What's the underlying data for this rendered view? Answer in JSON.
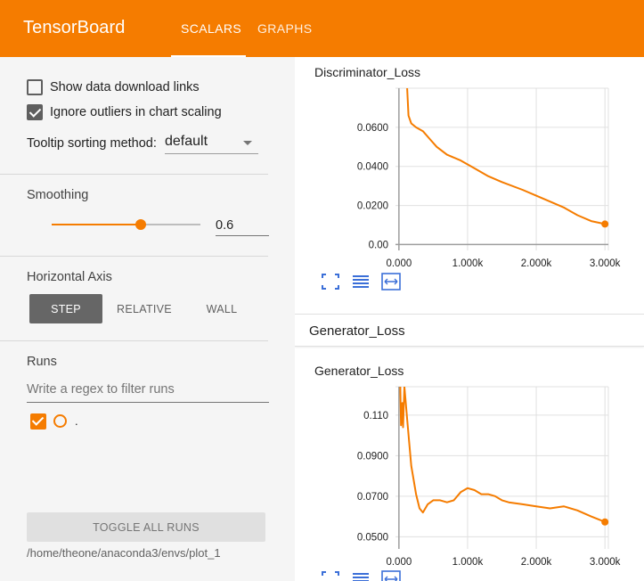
{
  "app": {
    "title": "TensorBoard",
    "tabs": [
      {
        "label": "SCALARS",
        "active": true
      },
      {
        "label": "GRAPHS",
        "active": false
      }
    ],
    "accent_color": "#f57c00"
  },
  "sidebar": {
    "show_download_links": {
      "label": "Show data download links",
      "checked": false
    },
    "ignore_outliers": {
      "label": "Ignore outliers in chart scaling",
      "checked": true
    },
    "tooltip_sorting": {
      "label": "Tooltip sorting method:",
      "value": "default"
    },
    "smoothing": {
      "title": "Smoothing",
      "value": "0.6",
      "fraction": 0.6
    },
    "horizontal_axis": {
      "title": "Horizontal Axis",
      "options": [
        "STEP",
        "RELATIVE",
        "WALL"
      ],
      "selected": "STEP"
    },
    "runs": {
      "title": "Runs",
      "filter_placeholder": "Write a regex to filter runs",
      "items": [
        {
          "name": ".",
          "checked": true,
          "color": "#f57c00"
        }
      ],
      "toggle_label": "TOGGLE ALL RUNS",
      "logdir": "/home/theone/anaconda3/envs/plot_1"
    }
  },
  "main": {
    "group_label": "Generator_Loss",
    "icons": [
      "fit-domain-icon",
      "log-scale-icon",
      "expand-icon"
    ]
  },
  "chart_data": [
    {
      "type": "line",
      "title": "Discriminator_Loss",
      "xlabel": "",
      "ylabel": "",
      "xlim": [
        -0.05,
        3.05
      ],
      "ylim": [
        -0.003,
        0.08
      ],
      "x_ticks": [
        0,
        1,
        2,
        3
      ],
      "x_tick_labels": [
        "0.000",
        "1.000k",
        "2.000k",
        "3.000k"
      ],
      "y_ticks": [
        0.0,
        0.02,
        0.04,
        0.06
      ],
      "y_tick_labels": [
        "0.00",
        "0.0200",
        "0.0400",
        "0.0600"
      ],
      "grid": true,
      "series": [
        {
          "x": [
            0.12,
            0.14,
            0.18,
            0.25,
            0.35,
            0.45,
            0.55,
            0.7,
            0.9,
            1.1,
            1.3,
            1.5,
            1.8,
            2.0,
            2.2,
            2.4,
            2.6,
            2.8,
            3.0
          ],
          "y": [
            0.08,
            0.066,
            0.062,
            0.06,
            0.058,
            0.054,
            0.05,
            0.046,
            0.043,
            0.039,
            0.035,
            0.032,
            0.028,
            0.025,
            0.022,
            0.019,
            0.015,
            0.012,
            0.0105
          ],
          "end_marker": true
        }
      ]
    },
    {
      "type": "line",
      "title": "Generator_Loss",
      "xlabel": "",
      "ylabel": "",
      "xlim": [
        -0.05,
        3.05
      ],
      "ylim": [
        0.044,
        0.124
      ],
      "x_ticks": [
        0,
        1,
        2,
        3
      ],
      "x_tick_labels": [
        "0.000",
        "1.000k",
        "2.000k",
        "3.000k"
      ],
      "y_ticks": [
        0.05,
        0.07,
        0.09,
        0.11
      ],
      "y_tick_labels": [
        "0.0500",
        "0.0700",
        "0.0900",
        "0.110"
      ],
      "grid": true,
      "series": [
        {
          "x": [
            0.02,
            0.03,
            0.05,
            0.06,
            0.08,
            0.12,
            0.18,
            0.25,
            0.3,
            0.35,
            0.42,
            0.5,
            0.6,
            0.7,
            0.8,
            0.9,
            1.0,
            1.1,
            1.2,
            1.3,
            1.4,
            1.5,
            1.6,
            1.8,
            2.0,
            2.2,
            2.4,
            2.6,
            2.8,
            3.0
          ],
          "y": [
            0.124,
            0.105,
            0.116,
            0.104,
            0.124,
            0.108,
            0.085,
            0.071,
            0.064,
            0.062,
            0.066,
            0.068,
            0.068,
            0.067,
            0.068,
            0.072,
            0.074,
            0.073,
            0.071,
            0.071,
            0.07,
            0.068,
            0.067,
            0.066,
            0.065,
            0.064,
            0.065,
            0.063,
            0.06,
            0.0573
          ],
          "end_marker": true
        }
      ]
    }
  ]
}
